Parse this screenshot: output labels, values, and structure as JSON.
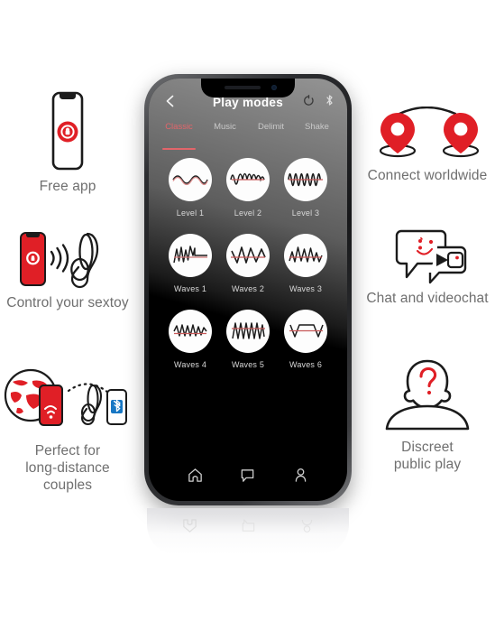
{
  "phone": {
    "header": {
      "title": "Play modes",
      "back_icon": "chevron-left-icon",
      "right_icons": [
        "refresh-power-icon",
        "bluetooth-icon"
      ]
    },
    "tabs": [
      {
        "label": "Classic",
        "active": true
      },
      {
        "label": "Music",
        "active": false
      },
      {
        "label": "Delimit",
        "active": false
      },
      {
        "label": "Shake",
        "active": false
      }
    ],
    "modes": [
      {
        "label": "Level 1",
        "icon": "waveform-level-1"
      },
      {
        "label": "Level 2",
        "icon": "waveform-level-2"
      },
      {
        "label": "Level 3",
        "icon": "waveform-level-3"
      },
      {
        "label": "Waves 1",
        "icon": "waveform-waves-1"
      },
      {
        "label": "Waves 2",
        "icon": "waveform-waves-2"
      },
      {
        "label": "Waves 3",
        "icon": "waveform-waves-3"
      },
      {
        "label": "Waves 4",
        "icon": "waveform-waves-4"
      },
      {
        "label": "Waves 5",
        "icon": "waveform-waves-5"
      },
      {
        "label": "Waves 6",
        "icon": "waveform-waves-6"
      }
    ],
    "bottom_nav": [
      {
        "name": "home",
        "icon": "home-icon"
      },
      {
        "name": "chat",
        "icon": "chat-bubble-icon"
      },
      {
        "name": "profile",
        "icon": "person-icon"
      }
    ]
  },
  "features": {
    "free_app": {
      "caption": "Free app",
      "icon": "phone-lock-icon"
    },
    "control_sextoy": {
      "caption": "Control your sextoy",
      "icon": "phone-signal-toy-icon"
    },
    "long_distance": {
      "caption": "Perfect for\nlong-distance\ncouples",
      "icon": "globe-phone-bluetooth-icon"
    },
    "connect": {
      "caption": "Connect worldwide",
      "icon": "two-map-pins-icon"
    },
    "chat_video": {
      "caption": "Chat and videochat",
      "icon": "speech-video-bubble-icon"
    },
    "discreet": {
      "caption": "Discreet\npublic play",
      "icon": "person-question-icon"
    }
  },
  "colors": {
    "brand_red": "#E01F26",
    "accent_pink": "#E2656A",
    "caption_gray": "#6F6F6F",
    "screen_black": "#000000",
    "bluetooth_blue": "#1777C4"
  }
}
